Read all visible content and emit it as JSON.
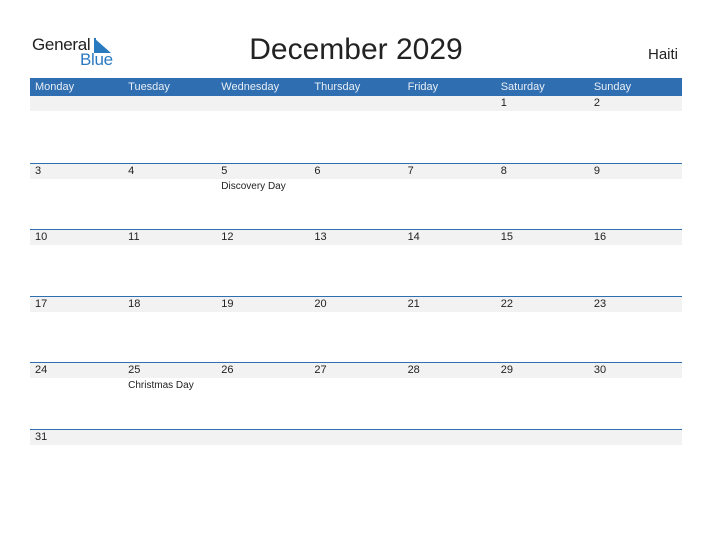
{
  "logo": {
    "word1": "General",
    "word2": "Blue"
  },
  "header": {
    "title": "December 2029",
    "country": "Haiti"
  },
  "colors": {
    "accent": "#2f6eb0",
    "strip": "#f2f2f2"
  },
  "weekdays": [
    "Monday",
    "Tuesday",
    "Wednesday",
    "Thursday",
    "Friday",
    "Saturday",
    "Sunday"
  ],
  "weeks": [
    [
      {
        "d": ""
      },
      {
        "d": ""
      },
      {
        "d": ""
      },
      {
        "d": ""
      },
      {
        "d": ""
      },
      {
        "d": "1"
      },
      {
        "d": "2"
      }
    ],
    [
      {
        "d": "3"
      },
      {
        "d": "4"
      },
      {
        "d": "5",
        "e": "Discovery Day"
      },
      {
        "d": "6"
      },
      {
        "d": "7"
      },
      {
        "d": "8"
      },
      {
        "d": "9"
      }
    ],
    [
      {
        "d": "10"
      },
      {
        "d": "11"
      },
      {
        "d": "12"
      },
      {
        "d": "13"
      },
      {
        "d": "14"
      },
      {
        "d": "15"
      },
      {
        "d": "16"
      }
    ],
    [
      {
        "d": "17"
      },
      {
        "d": "18"
      },
      {
        "d": "19"
      },
      {
        "d": "20"
      },
      {
        "d": "21"
      },
      {
        "d": "22"
      },
      {
        "d": "23"
      }
    ],
    [
      {
        "d": "24"
      },
      {
        "d": "25",
        "e": "Christmas Day"
      },
      {
        "d": "26"
      },
      {
        "d": "27"
      },
      {
        "d": "28"
      },
      {
        "d": "29"
      },
      {
        "d": "30"
      }
    ],
    [
      {
        "d": "31"
      },
      {
        "d": ""
      },
      {
        "d": ""
      },
      {
        "d": ""
      },
      {
        "d": ""
      },
      {
        "d": ""
      },
      {
        "d": ""
      }
    ]
  ]
}
